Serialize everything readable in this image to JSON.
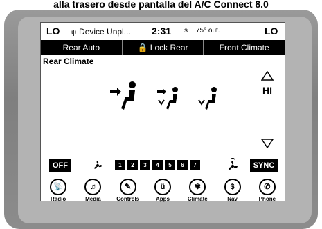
{
  "caption": "alla trasero desde pantalla del A/C Connect 8.0",
  "status": {
    "left_temp": "LO",
    "device": "Device Unpl...",
    "clock": "2:31",
    "units": "s",
    "outside_temp": "75° out.",
    "right_temp": "LO"
  },
  "tabs": [
    "Rear Auto",
    "Lock Rear",
    "Front Climate"
  ],
  "page_title": "Rear Climate",
  "temperature": {
    "value": "HI",
    "up_icon": "triangle-up-icon",
    "down_icon": "triangle-down-icon"
  },
  "buttons": {
    "off": "OFF",
    "sync": "SYNC"
  },
  "fan_steps": [
    "1",
    "2",
    "3",
    "4",
    "5",
    "6",
    "7"
  ],
  "dock": [
    {
      "label": "Radio",
      "icon": "radio-icon",
      "glyph": "📡"
    },
    {
      "label": "Media",
      "icon": "music-note-icon",
      "glyph": "♫"
    },
    {
      "label": "Controls",
      "icon": "wrench-icon",
      "glyph": "✎"
    },
    {
      "label": "Apps",
      "icon": "apps-icon",
      "glyph": "ü"
    },
    {
      "label": "Climate",
      "icon": "fan-icon",
      "glyph": "✾"
    },
    {
      "label": "Nav",
      "icon": "compass-icon",
      "glyph": "$"
    },
    {
      "label": "Phone",
      "icon": "phone-icon",
      "glyph": "✆"
    }
  ]
}
